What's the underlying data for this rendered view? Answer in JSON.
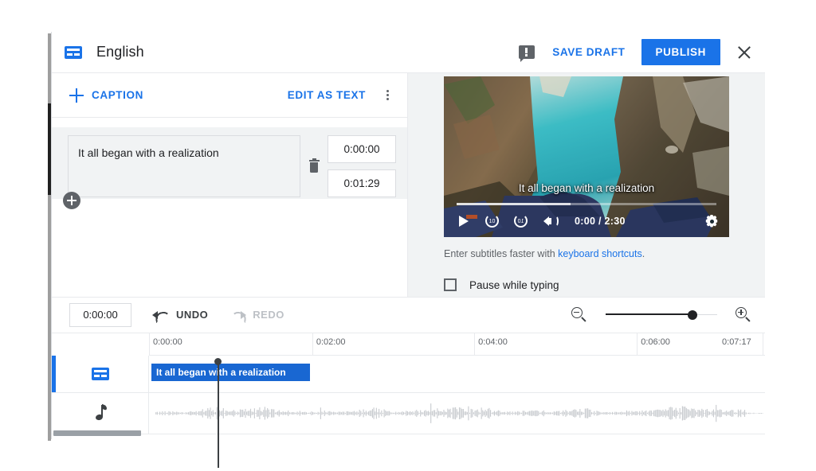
{
  "header": {
    "language_title": "English",
    "cc_icon": "closed-caption-icon",
    "feedback_icon": "feedback-icon",
    "save_draft_label": "SAVE DRAFT",
    "publish_label": "PUBLISH",
    "close_icon": "close-icon"
  },
  "caption_toolbar": {
    "add_caption_label": "CAPTION",
    "plus_icon": "plus-icon",
    "edit_as_text_label": "EDIT AS TEXT",
    "overflow_icon": "more-vert-icon"
  },
  "captions": [
    {
      "text": "It all began with a realization",
      "start_time": "0:00:00",
      "end_time": "0:01:29",
      "delete_icon": "trash-icon"
    }
  ],
  "add_caption_fab": "add-circle-icon",
  "player": {
    "subtitle_overlay": "It all began with a realization",
    "play_icon": "play-icon",
    "rewind_label": "10",
    "forward_label": "10",
    "volume_icon": "volume-icon",
    "current_time": "0:00",
    "duration": "2:30",
    "time_display": "0:00 / 2:30",
    "settings_icon": "settings-gear-icon",
    "progress_percent": 0,
    "buffered_percent": 44
  },
  "hint": {
    "prefix": "Enter subtitles faster with ",
    "link_label": "keyboard shortcuts",
    "suffix": "."
  },
  "pause_while_typing": {
    "label": "Pause while typing",
    "checked": false
  },
  "bottom_toolbar": {
    "timecode_value": "0:00:00",
    "undo_label": "UNDO",
    "redo_label": "REDO",
    "undo_enabled": true,
    "redo_enabled": false,
    "zoom_out_icon": "zoom-out-icon",
    "zoom_in_icon": "zoom-in-icon",
    "zoom_slider_percent": 78
  },
  "timeline": {
    "ticks": [
      {
        "label": "0:00:00",
        "left_percent": 0
      },
      {
        "label": "0:02:00",
        "left_percent": 26.5
      },
      {
        "label": "0:04:00",
        "left_percent": 52.8
      },
      {
        "label": "0:06:00",
        "left_percent": 79.2
      },
      {
        "label": "0:07:17",
        "left_percent": 95.5
      }
    ],
    "tracks": [
      {
        "type": "caption",
        "icon": "closed-caption-icon",
        "block_label": "It all began with a realization"
      },
      {
        "type": "audio",
        "icon": "music-note-icon"
      }
    ]
  },
  "colors": {
    "accent_blue": "#1a73e8",
    "block_blue": "#1967d2",
    "panel_gray": "#f1f3f4",
    "text_primary": "#202124",
    "text_secondary": "#5f6368",
    "disabled": "#bdc1c6"
  }
}
